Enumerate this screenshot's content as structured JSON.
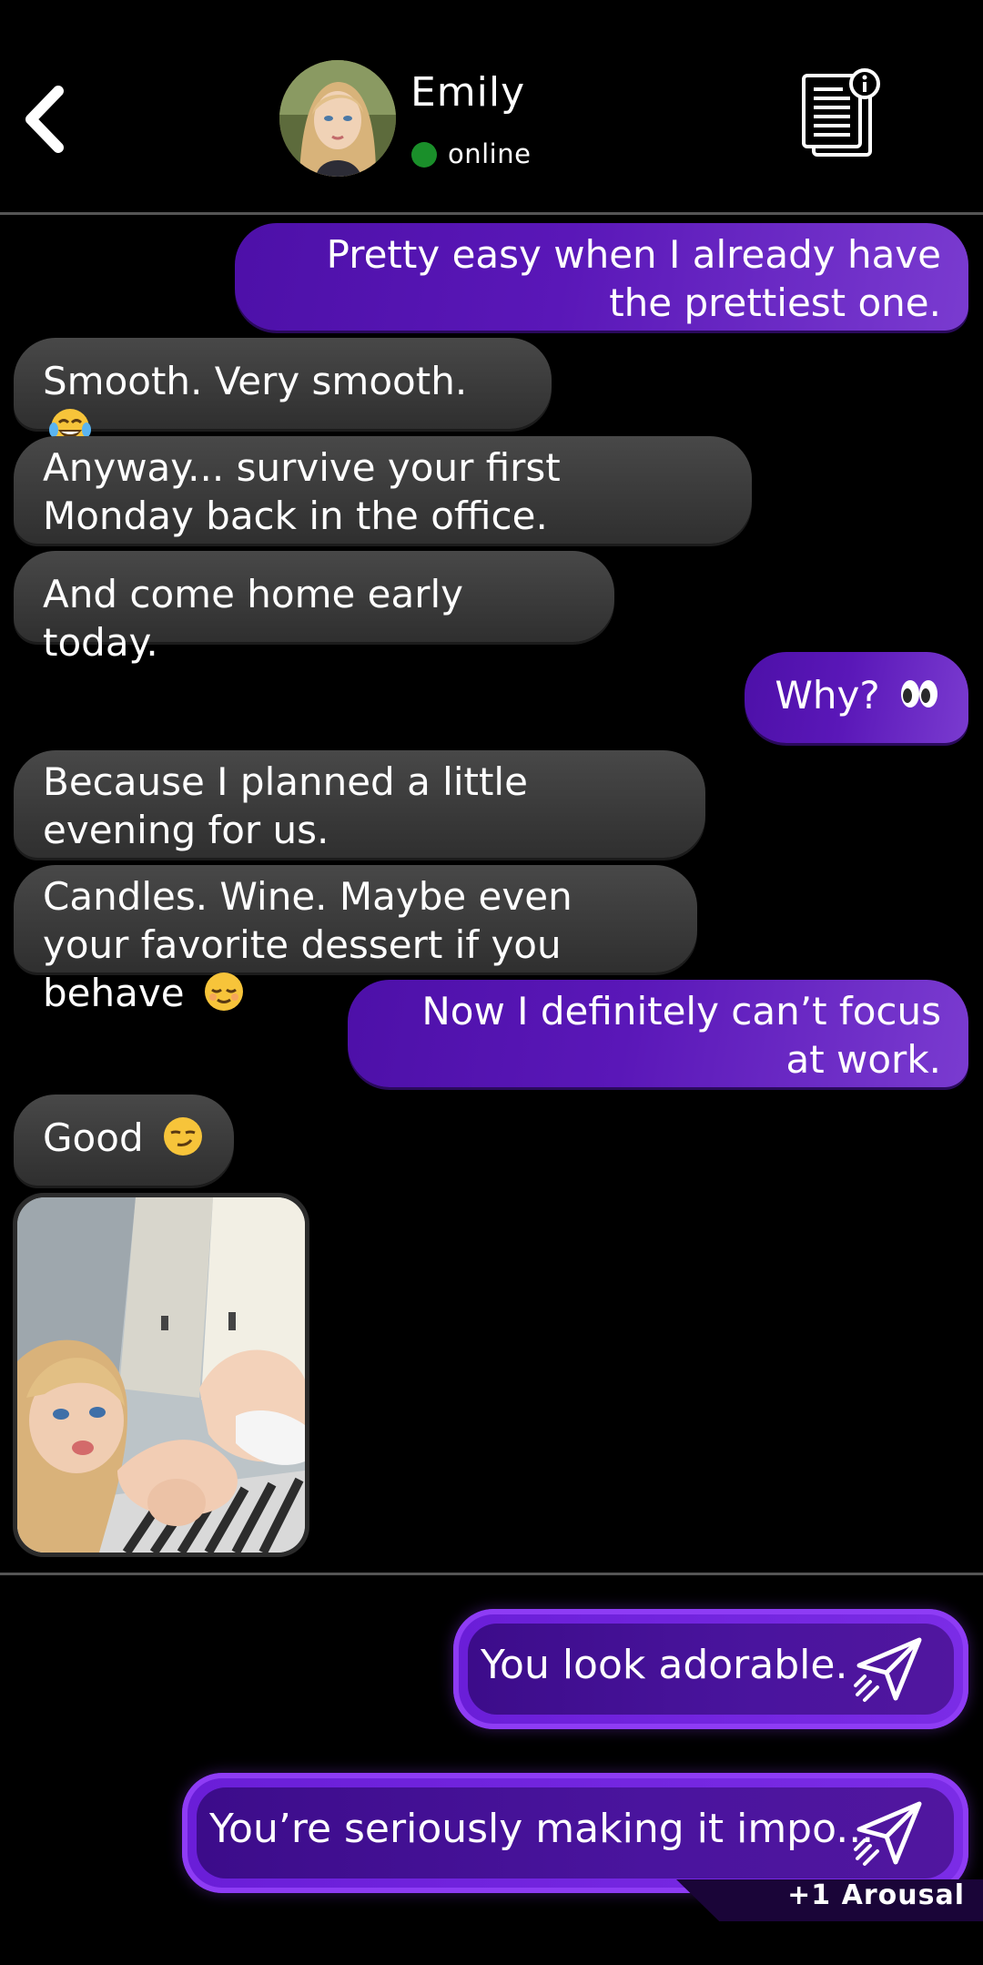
{
  "header": {
    "contact_name": "Emily",
    "status": "online",
    "status_color": "#1a8f2a"
  },
  "icons": {
    "back": "chevron-left-icon",
    "info": "document-info-icon",
    "send": "paper-plane-icon"
  },
  "messages": [
    {
      "from": "me",
      "text": "Pretty easy when I already have the prettiest one."
    },
    {
      "from": "her",
      "text": "Smooth. Very smooth.",
      "emoji": "😂"
    },
    {
      "from": "her",
      "text": "Anyway... survive your first Monday back in the office."
    },
    {
      "from": "her",
      "text": "And come home early today."
    },
    {
      "from": "me",
      "text": "Why?",
      "emoji": "👀"
    },
    {
      "from": "her",
      "text": "Because I planned a little evening for us."
    },
    {
      "from": "her",
      "text": "Candles. Wine. Maybe even your favorite dessert if you behave",
      "emoji": "😌"
    },
    {
      "from": "me",
      "text": "Now I definitely can’t focus at work."
    },
    {
      "from": "her",
      "text": "Good",
      "emoji": "😏"
    },
    {
      "from": "her",
      "type": "photo"
    }
  ],
  "reply_options": [
    {
      "text": "You look adorable."
    },
    {
      "text": "You’re seriously making it impo...",
      "reward": "+1 Arousal"
    }
  ],
  "colors": {
    "outgoing_bubble": "#5a17b8",
    "incoming_bubble": "#3a3a3a",
    "reply_border": "#8e3cf5",
    "background": "#000000"
  }
}
